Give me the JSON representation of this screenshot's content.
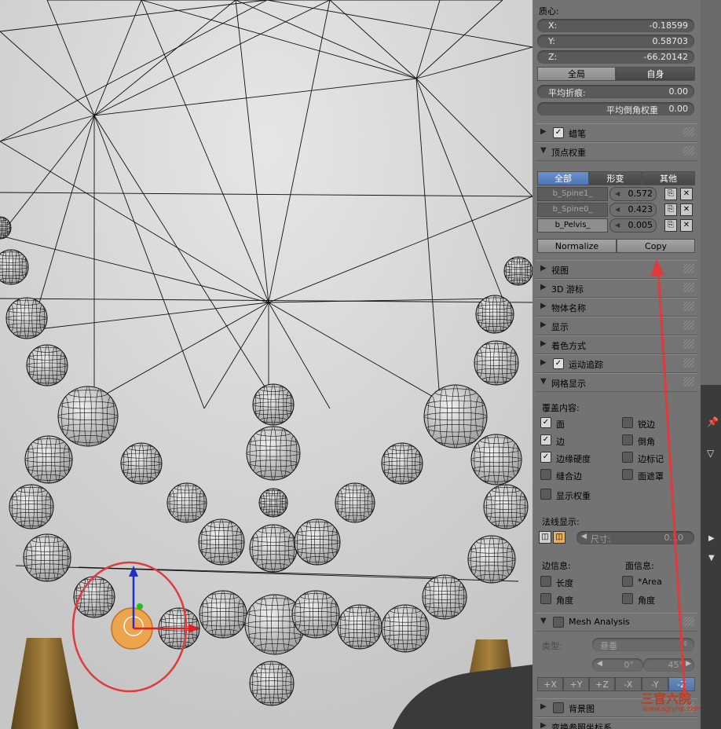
{
  "centroid": {
    "title": "质心:",
    "x_label": "X:",
    "x_value": "-0.18599",
    "y_label": "Y:",
    "y_value": "0.58703",
    "z_label": "Z:",
    "z_value": "-66.20142",
    "global_label": "全局",
    "local_label": "自身"
  },
  "mean_crease": {
    "label": "平均折痕:",
    "value": "0.00"
  },
  "mean_bevel": {
    "label": "平均倒角权重",
    "value": "0.00"
  },
  "panels": {
    "grease_pencil": "蜡笔",
    "vertex_weights": "顶点权重",
    "view": "视图",
    "cursor_3d": "3D 游标",
    "object_name": "物体名称",
    "display": "显示",
    "shading": "着色方式",
    "motion_tracking": "运动追踪",
    "mesh_display": "网格显示",
    "mesh_analysis": "Mesh Analysis",
    "background_images": "背景图",
    "transform_orientations": "变换参照坐标系"
  },
  "vw_tabs": [
    "全部",
    "形变",
    "其他"
  ],
  "vertex_groups": [
    {
      "name": "b_Spine1_",
      "value": "0.572"
    },
    {
      "name": "b_Spine0_",
      "value": "0.423"
    },
    {
      "name": "b_Pelvis_",
      "value": "0.005"
    }
  ],
  "normalize_label": "Normalize",
  "copy_label": "Copy",
  "overlays": {
    "title": "覆盖内容:",
    "faces": "面",
    "sharp": "锐边",
    "edges": "边",
    "bevel": "倒角",
    "crease": "边缘硬度",
    "seams_mark": "边标记",
    "seams": "缝合边",
    "face_mask": "面遮罩",
    "show_weights": "显示权重"
  },
  "normals": {
    "title": "法线显示:",
    "size_label": "尺寸:",
    "size_value": "0.10"
  },
  "edge_info": {
    "title": "边信息:",
    "length": "长度",
    "angle": "角度"
  },
  "face_info": {
    "title": "面信息:",
    "area": "*Area",
    "angle": "角度"
  },
  "analysis": {
    "type_label": "类型:",
    "type_value": "悬垂",
    "min": "0°",
    "max": "45°",
    "axes": [
      "+X",
      "+Y",
      "+Z",
      "-X",
      "-Y",
      "-Z"
    ]
  },
  "watermark": {
    "text": "三官六院",
    "url": "www.sglynp.com"
  },
  "colors": {
    "panel_bg": "#737373",
    "selected_tab": "#5a84c4",
    "annotation": "#e03a3a"
  }
}
